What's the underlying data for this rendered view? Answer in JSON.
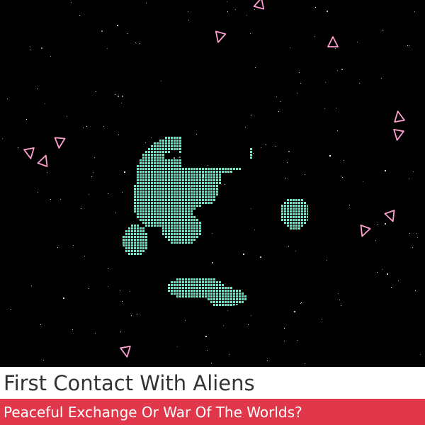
{
  "title": "First Contact With Aliens",
  "subtitle": "Peaceful Exchange Or War Of The Worlds?",
  "colors": {
    "background": "#000000",
    "planet": "#5ef0c8",
    "ship": "#ff9fd0",
    "star": "#ffffff",
    "title_bg": "#ffffff",
    "title_text": "#333333",
    "subtitle_bg": "#e0384a",
    "subtitle_text": "#ffffff"
  }
}
